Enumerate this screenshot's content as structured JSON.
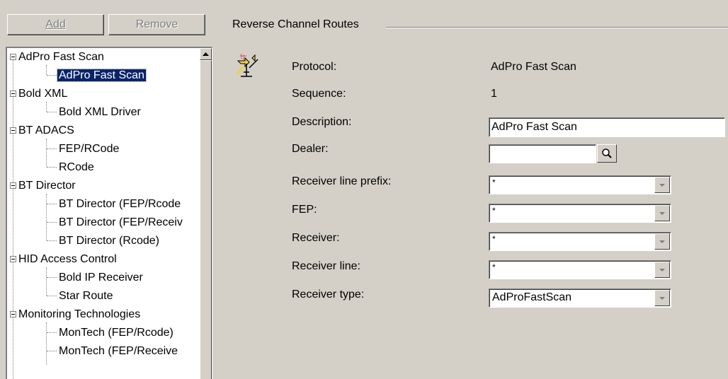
{
  "toolbar": {
    "add_label": "Add",
    "remove_label": "Remove"
  },
  "tree": {
    "items": [
      {
        "label": "AdPro Fast Scan",
        "level": 0
      },
      {
        "label": "AdPro Fast Scan",
        "level": 1,
        "selected": true
      },
      {
        "label": "Bold XML",
        "level": 0
      },
      {
        "label": "Bold XML Driver",
        "level": 1
      },
      {
        "label": "BT ADACS",
        "level": 0
      },
      {
        "label": "FEP/RCode",
        "level": 1
      },
      {
        "label": "RCode",
        "level": 1
      },
      {
        "label": "BT Director",
        "level": 0
      },
      {
        "label": "BT Director (FEP/Rcode",
        "level": 1
      },
      {
        "label": "BT Director (FEP/Receiv",
        "level": 1
      },
      {
        "label": "BT Director (Rcode)",
        "level": 1
      },
      {
        "label": "HID Access Control",
        "level": 0
      },
      {
        "label": "Bold IP Receiver",
        "level": 1
      },
      {
        "label": "Star Route",
        "level": 1
      },
      {
        "label": "Monitoring Technologies",
        "level": 0
      },
      {
        "label": "MonTech (FEP/Rcode)",
        "level": 1
      },
      {
        "label": "MonTech (FEP/Receive",
        "level": 1
      }
    ]
  },
  "details": {
    "group_title": "Reverse Channel Routes",
    "icon": "route-icon",
    "protocol_label": "Protocol:",
    "protocol_value": "AdPro Fast Scan",
    "sequence_label": "Sequence:",
    "sequence_value": "1",
    "description_label": "Description:",
    "description_value": "AdPro Fast Scan",
    "dealer_label": "Dealer:",
    "dealer_value": "",
    "receiver_line_prefix_label": "Receiver line prefix:",
    "receiver_line_prefix_value": "*",
    "fep_label": "FEP:",
    "fep_value": "*",
    "receiver_label": "Receiver:",
    "receiver_value": "*",
    "receiver_line_label": "Receiver line:",
    "receiver_line_value": "*",
    "receiver_type_label": "Receiver type:",
    "receiver_type_value": "AdProFastScan"
  }
}
